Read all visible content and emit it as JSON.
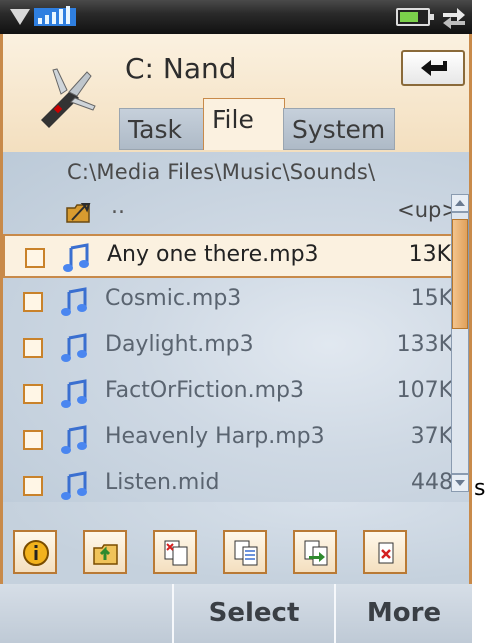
{
  "status_bar": {
    "signal_icon": "signal-triangle-icon",
    "bars_icon": "signal-bars-icon",
    "battery_icon": "battery-icon",
    "sync_icon": "sync-icon"
  },
  "header": {
    "app_icon": "swiss-knife-icon",
    "title": "C: Nand",
    "back_icon": "back-arrow-icon",
    "tabs": [
      {
        "label": "Task",
        "active": false
      },
      {
        "label": "File",
        "active": true
      },
      {
        "label": "System",
        "active": false
      }
    ]
  },
  "browser": {
    "path": "C:\\Media Files\\Music\\Sounds\\",
    "up": {
      "dots": "..",
      "label": "<up>"
    },
    "files": [
      {
        "name": "Any one there.mp3",
        "size": "13K",
        "selected": true
      },
      {
        "name": "Cosmic.mp3",
        "size": "15K",
        "selected": false
      },
      {
        "name": "Daylight.mp3",
        "size": "133K",
        "selected": false
      },
      {
        "name": "FactOrFiction.mp3",
        "size": "107K",
        "selected": false
      },
      {
        "name": "Heavenly Harp.mp3",
        "size": "37K",
        "selected": false
      },
      {
        "name": "Listen.mid",
        "size": "448",
        "selected": false
      }
    ]
  },
  "toolbar": {
    "buttons": [
      "info-icon",
      "up-folder-icon",
      "cut-icon",
      "copy-icon",
      "paste-icon",
      "delete-icon"
    ]
  },
  "softkeys": {
    "left": "",
    "select": "Select",
    "more": "More"
  },
  "edge_text": "s",
  "colors": {
    "accent": "#c88a4a",
    "header_bg": "#fbf1e0",
    "content_bg": "#cfd9e4",
    "tab_bg": "#b6c2cf"
  }
}
